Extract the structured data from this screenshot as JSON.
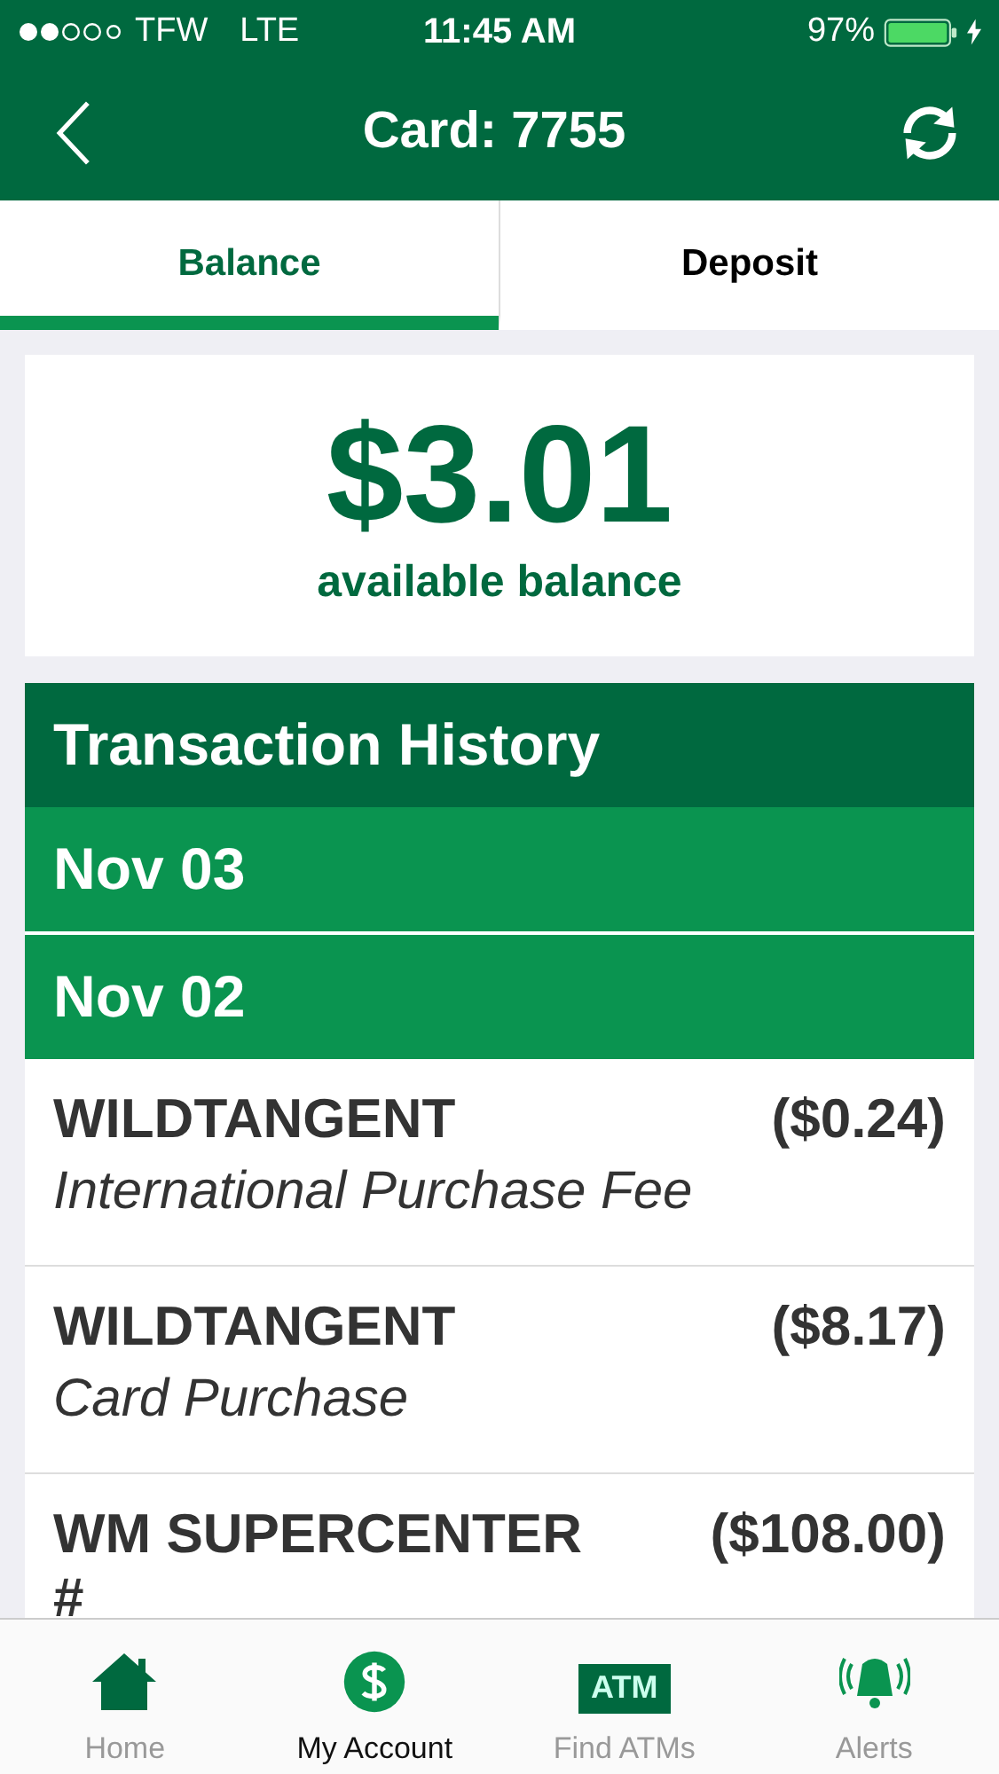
{
  "status_bar": {
    "carrier": "TFW",
    "network": "LTE",
    "time": "11:45 AM",
    "battery": "97%"
  },
  "nav": {
    "title": "Card: 7755"
  },
  "tabs": [
    {
      "label": "Balance",
      "selected": true
    },
    {
      "label": "Deposit",
      "selected": false
    }
  ],
  "balance": {
    "amount": "$3.01",
    "caption": "available balance"
  },
  "history": {
    "title": "Transaction History",
    "groups": [
      {
        "date": "Nov 03"
      },
      {
        "date": "Nov 02",
        "transactions": [
          {
            "merchant": "WILDTANGENT",
            "amount": "($0.24)",
            "description": "International Purchase Fee"
          },
          {
            "merchant": "WILDTANGENT",
            "amount": "($8.17)",
            "description": "Card Purchase"
          },
          {
            "merchant": "WM SUPERCENTER #",
            "amount": "($108.00)"
          }
        ]
      }
    ]
  },
  "tab_bar": [
    {
      "kind": "home",
      "label": "Home",
      "selected": false
    },
    {
      "kind": "account",
      "label": "My Account",
      "selected": true
    },
    {
      "kind": "atm",
      "label": "Find ATMs",
      "icon_text": "ATM",
      "selected": false
    },
    {
      "kind": "alerts",
      "label": "Alerts",
      "selected": false
    }
  ]
}
